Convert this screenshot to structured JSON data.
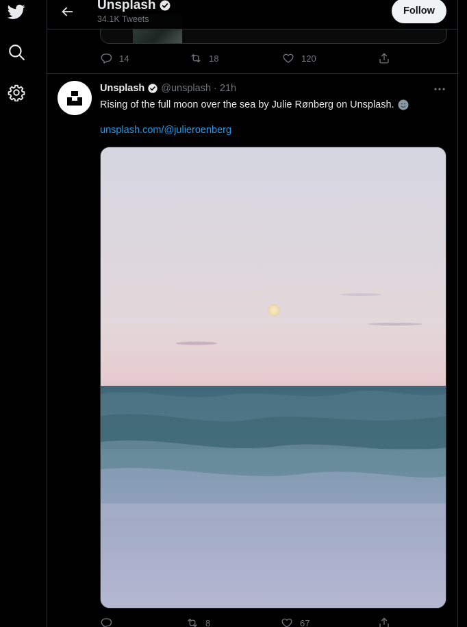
{
  "header": {
    "title": "Unsplash",
    "subtitle": "34.1K Tweets",
    "follow_label": "Follow"
  },
  "prev_tweet": {
    "reply_count": "14",
    "retweet_count": "18",
    "like_count": "120"
  },
  "tweet": {
    "author_name": "Unsplash",
    "handle": "@unsplash",
    "separator": "·",
    "time": "21h",
    "text": "Rising of the full moon over the sea by Julie Rønberg on Unsplash.",
    "link": "unsplash.com/@julieroenberg",
    "photo_description_icon": "photo",
    "reply_count": "",
    "retweet_count": "8",
    "like_count": "67"
  },
  "icons": {
    "twitter": "twitter-logo-icon",
    "search": "search-icon",
    "settings": "gear-icon",
    "back": "arrow-left-icon",
    "verified": "verified-badge-icon",
    "more": "more-dots-icon",
    "reply": "reply-icon",
    "retweet": "retweet-icon",
    "like": "heart-icon",
    "share": "share-icon",
    "emoji": "smiling-face-icon"
  },
  "colors": {
    "background": "#000000",
    "text": "#e7e9ea",
    "muted": "#71767b",
    "link": "#1d9bf0",
    "border": "#2f3336",
    "follow_bg": "#eff3f4"
  }
}
